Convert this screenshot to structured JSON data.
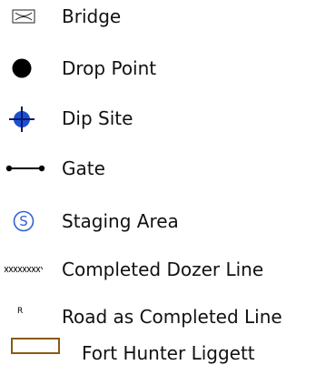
{
  "legend": {
    "items": [
      {
        "key": "bridge",
        "label": "Bridge",
        "icon": "bridge-icon"
      },
      {
        "key": "drop_point",
        "label": "Drop Point",
        "icon": "filled-circle-icon"
      },
      {
        "key": "dip_site",
        "label": "Dip Site",
        "icon": "crosshair-circle-icon",
        "color": "#1a4fd6"
      },
      {
        "key": "gate",
        "label": "Gate",
        "icon": "line-with-dots-icon"
      },
      {
        "key": "staging_area",
        "label": "Staging Area",
        "icon": "circled-s-icon",
        "color": "#2f5fd8"
      },
      {
        "key": "completed_dozer_line",
        "label": "Completed Dozer Line",
        "icon": "hatched-line-icon"
      },
      {
        "key": "road_as_completed_line",
        "label": "Road as Completed Line",
        "icon": "letter-r-icon"
      },
      {
        "key": "fort_hunter_liggett",
        "label": "Fort Hunter Liggett",
        "icon": "outlined-rectangle-icon",
        "color": "#8a5a12"
      }
    ],
    "symbol_texts": {
      "road_marker": "R",
      "staging_marker": "S"
    }
  }
}
